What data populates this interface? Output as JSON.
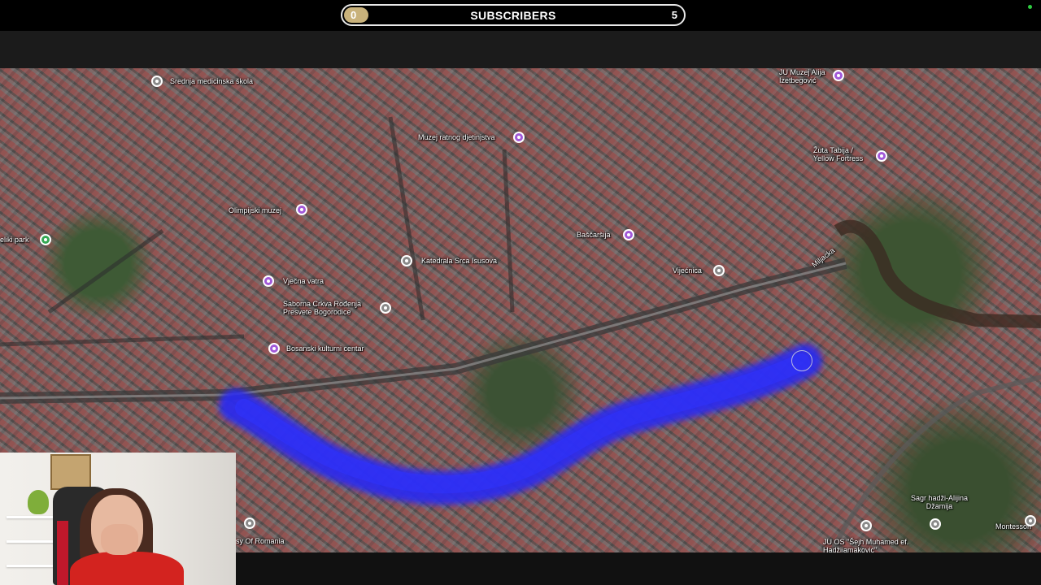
{
  "subscriber_goal": {
    "title": "SUBSCRIBERS",
    "start": "0",
    "goal": "5",
    "progress_fraction": 0.0,
    "fill_color": "#c9b27b"
  },
  "map": {
    "type": "satellite",
    "route_color": "#2a2cf0",
    "places": {
      "srednja": "Srednja medicinska škola",
      "muzej_ratnog": "Muzej ratnog djetinjstva",
      "muzej_alija": "JU Muzej Alija Izetbegović",
      "zuta_tabija": "Žuta Tabija / Yellow Fortress",
      "olimpijski": "Olimpijski muzej",
      "baščaršija": "Baščaršija",
      "katedrala": "Katedrala Srca Isusova",
      "vijecnica": "Vijećnica",
      "miljacka": "Miljacka",
      "vjecna_vatra": "Vječna vatra",
      "saborna": "Saborna Crkva Rođenja Presvete Bogorodice",
      "bosanski": "Bosanski kulturni centar",
      "eliki_park": "eliki park",
      "embassy": "sy Of Romania",
      "sagr": "Sagr hadži-Alijina Džamija",
      "montessori": "Montessori",
      "ju_os": "JU OS \"Šejh Muhamed ef. Hadžijamaković\""
    }
  }
}
